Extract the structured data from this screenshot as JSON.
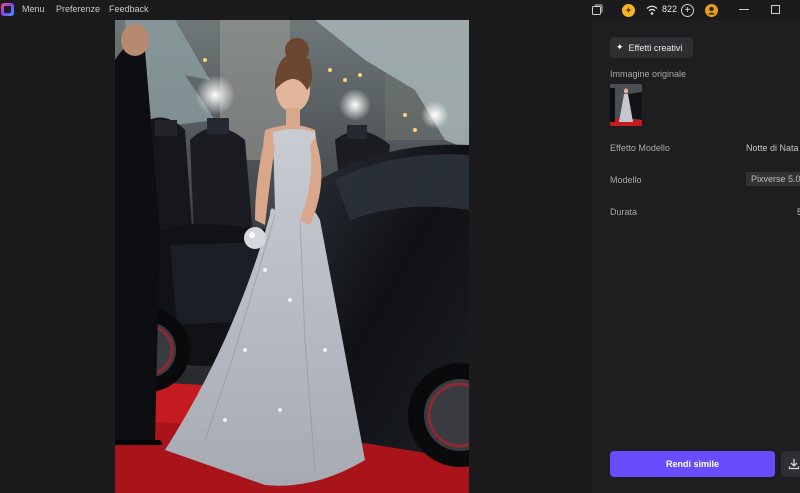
{
  "topbar": {
    "menu": [
      "Menu",
      "Preferenze",
      "Feedback"
    ],
    "credits": "822",
    "icons": [
      "app-logo-icon",
      "gallery-icon",
      "coin-icon",
      "wifi-icon",
      "plus-icon",
      "user-icon",
      "minimize-icon",
      "maximize-icon"
    ]
  },
  "panel": {
    "effects_button": "Effetti creativi",
    "original_image_label": "Immagine originale",
    "effect_model_label": "Effetto Modello",
    "effect_model_value": "Notte di Nata",
    "model_label": "Modello",
    "model_value": "Pixverse 5.0",
    "duration_label": "Durata",
    "duration_value": "5",
    "render_button": "Rendi simile"
  },
  "colors": {
    "background": "#1b1b1d",
    "panel": "#1e1e21",
    "accent": "#6a4cff",
    "coin": "#f5b522",
    "carpet": "#c51a1f"
  }
}
